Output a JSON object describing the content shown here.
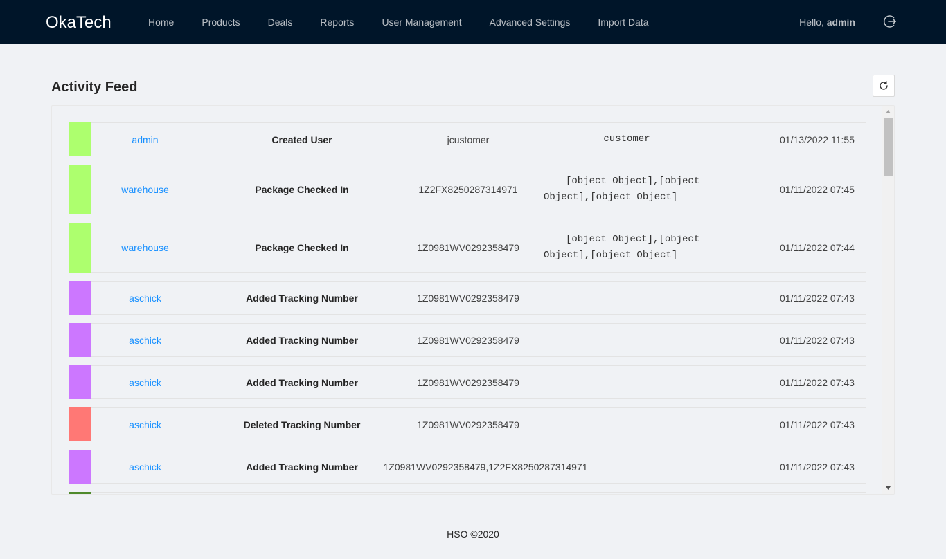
{
  "app": {
    "brand": "OkaTech"
  },
  "nav": {
    "items": [
      {
        "label": "Home"
      },
      {
        "label": "Products"
      },
      {
        "label": "Deals"
      },
      {
        "label": "Reports"
      },
      {
        "label": "User Management"
      },
      {
        "label": "Advanced Settings"
      },
      {
        "label": "Import Data"
      }
    ],
    "greeting_prefix": "Hello, ",
    "username": "admin",
    "logout_icon": "logout-icon"
  },
  "page": {
    "title": "Activity Feed",
    "refresh_icon": "refresh-icon"
  },
  "colors": {
    "created": "#adff6e",
    "added": "#cc77ff",
    "deleted": "#ff7875",
    "other": "#4f8a2b",
    "link": "#1890ff",
    "header_bg": "#001529"
  },
  "feed": {
    "rows": [
      {
        "user": "admin",
        "action": "Created User",
        "target": "jcustomer",
        "data_line1": "customer",
        "data_line2": "",
        "time": "01/13/2022 11:55",
        "color": "#adff6e"
      },
      {
        "user": "warehouse",
        "action": "Package Checked In",
        "target": "1Z2FX8250287314971",
        "data_line1": "[object Object],[object",
        "data_line2": "Object],[object Object]",
        "time": "01/11/2022 07:45",
        "color": "#adff6e"
      },
      {
        "user": "warehouse",
        "action": "Package Checked In",
        "target": "1Z0981WV0292358479",
        "data_line1": "[object Object],[object",
        "data_line2": "Object],[object Object]",
        "time": "01/11/2022 07:44",
        "color": "#adff6e"
      },
      {
        "user": "aschick",
        "action": "Added Tracking Number",
        "target": "1Z0981WV0292358479",
        "data_line1": "",
        "data_line2": "",
        "time": "01/11/2022 07:43",
        "color": "#cc77ff"
      },
      {
        "user": "aschick",
        "action": "Added Tracking Number",
        "target": "1Z0981WV0292358479",
        "data_line1": "",
        "data_line2": "",
        "time": "01/11/2022 07:43",
        "color": "#cc77ff"
      },
      {
        "user": "aschick",
        "action": "Added Tracking Number",
        "target": "1Z0981WV0292358479",
        "data_line1": "",
        "data_line2": "",
        "time": "01/11/2022 07:43",
        "color": "#cc77ff"
      },
      {
        "user": "aschick",
        "action": "Deleted Tracking Number",
        "target": "1Z0981WV0292358479",
        "data_line1": "",
        "data_line2": "",
        "time": "01/11/2022 07:43",
        "color": "#ff7875"
      },
      {
        "user": "aschick",
        "action": "Added Tracking Number",
        "target": "1Z0981WV0292358479,1Z2FX8250287314971",
        "data_line1": "",
        "data_line2": "",
        "time": "01/11/2022 07:43",
        "color": "#cc77ff"
      },
      {
        "user": "",
        "action": "",
        "target": "",
        "data_line1": "",
        "data_line2": "",
        "time": "",
        "color": "#4f8a2b"
      }
    ]
  },
  "scrollbar": {
    "up_icon": "scroll-up-arrow-icon",
    "down_icon": "scroll-down-arrow-icon"
  },
  "footer": {
    "text": "HSO ©2020"
  }
}
